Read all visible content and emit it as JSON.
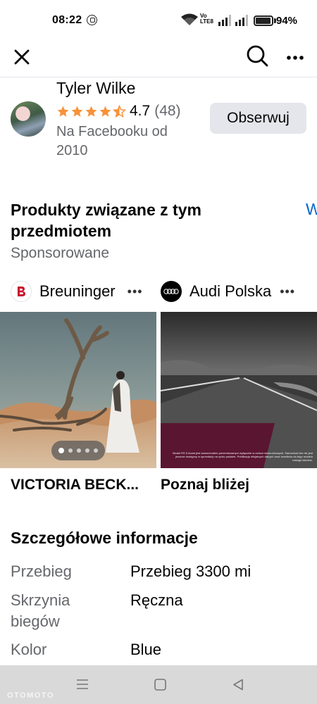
{
  "status_bar": {
    "time": "08:22",
    "network_label_top": "Vo",
    "network_label_bottom": "LTE8",
    "battery_percent": "94%",
    "battery_level": 0.94
  },
  "seller": {
    "name": "Tyler Wilke",
    "rating": "4.7",
    "rating_count": "(48)",
    "stars_filled": 4.5,
    "since": "Na Facebooku od 2010",
    "follow_label": "Obserwuj"
  },
  "related": {
    "title": "Produkty związane z tym przedmiotem",
    "see_all": "W",
    "sponsored": "Sponsorowane",
    "cards": [
      {
        "advertiser": "Breuninger",
        "title": "VICTORIA BECK...",
        "carousel_pages": 5,
        "carousel_active": 1
      },
      {
        "advertiser": "Audi Polska",
        "title": "Poznaj bliżej",
        "disclaimer": "Model RS 5 Avant jest samochodem prezentowanym wyłącznie w celach wizerunkowych. Samochód ten nie jest jeszcze dostępny w sprzedaży na rynku polskim. Publikacja oficjalnych danych oraz cenników do tego modelu nastąpi wkrótce."
      }
    ],
    "more_symbol": "•••"
  },
  "details": {
    "title": "Szczegółowe informacje",
    "rows": [
      {
        "label": "Przebieg",
        "value": "Przebieg 3300 mi"
      },
      {
        "label": "Skrzynia biegów",
        "value": "Ręczna"
      },
      {
        "label": "Kolor",
        "value": "Blue"
      }
    ]
  },
  "watermark": "OTOMOTO",
  "colors": {
    "star": "#f7923a",
    "link": "#0064d1",
    "secondary_text": "#65676b",
    "button_bg": "#e4e6eb",
    "breuninger_red": "#c8102e",
    "audi_black": "#000000"
  }
}
